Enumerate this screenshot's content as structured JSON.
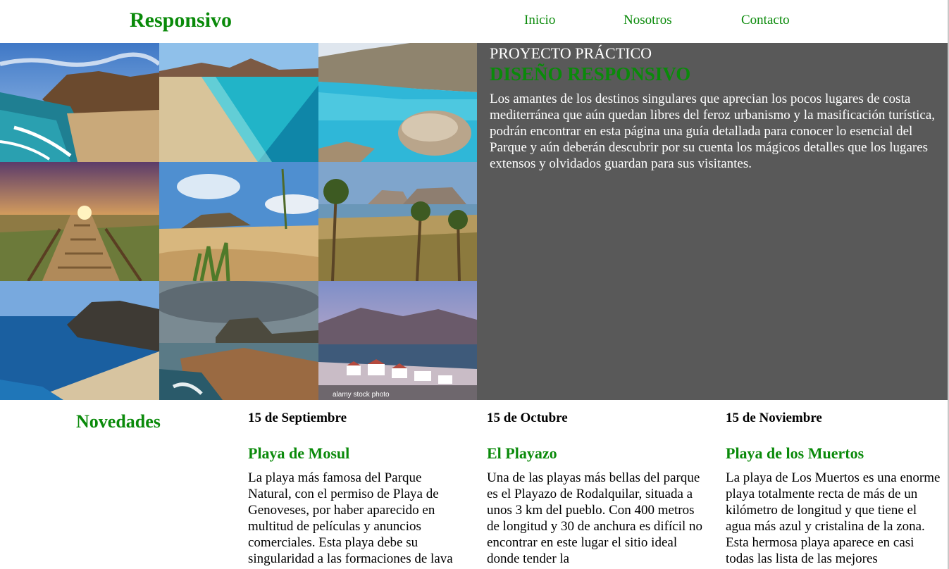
{
  "header": {
    "logo": "Responsivo",
    "nav": [
      "Inicio",
      "Nosotros",
      "Contacto"
    ]
  },
  "gallery": {
    "photos": [
      "beach-cliffs-waves-photo",
      "turquoise-beach-photo",
      "rocky-cove-photo",
      "boardwalk-sunset-photo",
      "dunes-agave-photo",
      "palm-coast-photo",
      "cliff-sea-beach-photo",
      "stormy-coast-photo",
      "white-village-bay-photo"
    ],
    "watermark": "alamy stock photo"
  },
  "intro": {
    "kicker": "PROYECTO PRÁCTICO",
    "title": "DISEÑO RESPONSIVO",
    "text": "Los amantes de los destinos singulares que aprecian los pocos lugares de costa mediterránea que aún quedan libres del feroz urbanismo y la masificación turística, podrán encontrar en esta página una guía detallada para conocer lo esencial del Parque y aún deberán descubrir por su cuenta los mágicos detalles que los lugares extensos y olvidados guardan para sus visitantes."
  },
  "news": {
    "heading": "Novedades",
    "items": [
      {
        "date": "15 de Septiembre",
        "title": "Playa de Mosul",
        "text": "La playa más famosa del Parque Natural, con el permiso de Playa de Genoveses, por haber aparecido en multitud de películas y anuncios comerciales. Esta playa debe su singularidad a las formaciones de lava"
      },
      {
        "date": "15 de Octubre",
        "title": "El Playazo",
        "text": "Una de las playas más bellas del parque es el Playazo de Rodalquilar, situada a unos 3 km del pueblo. Con 400 metros de longitud y 30 de anchura es difícil no encontrar en este lugar el sitio ideal donde tender la"
      },
      {
        "date": "15 de Noviembre",
        "title": "Playa de los Muertos",
        "text": "La playa de Los Muertos es una enorme playa totalmente recta de más de un kilómetro de longitud y que tiene el agua más azul y cristalina de la zona. Esta hermosa playa aparece en casi todas las lista de las mejores"
      }
    ]
  },
  "colors": {
    "accent": "#0a8a0a",
    "panel": "#595959"
  }
}
